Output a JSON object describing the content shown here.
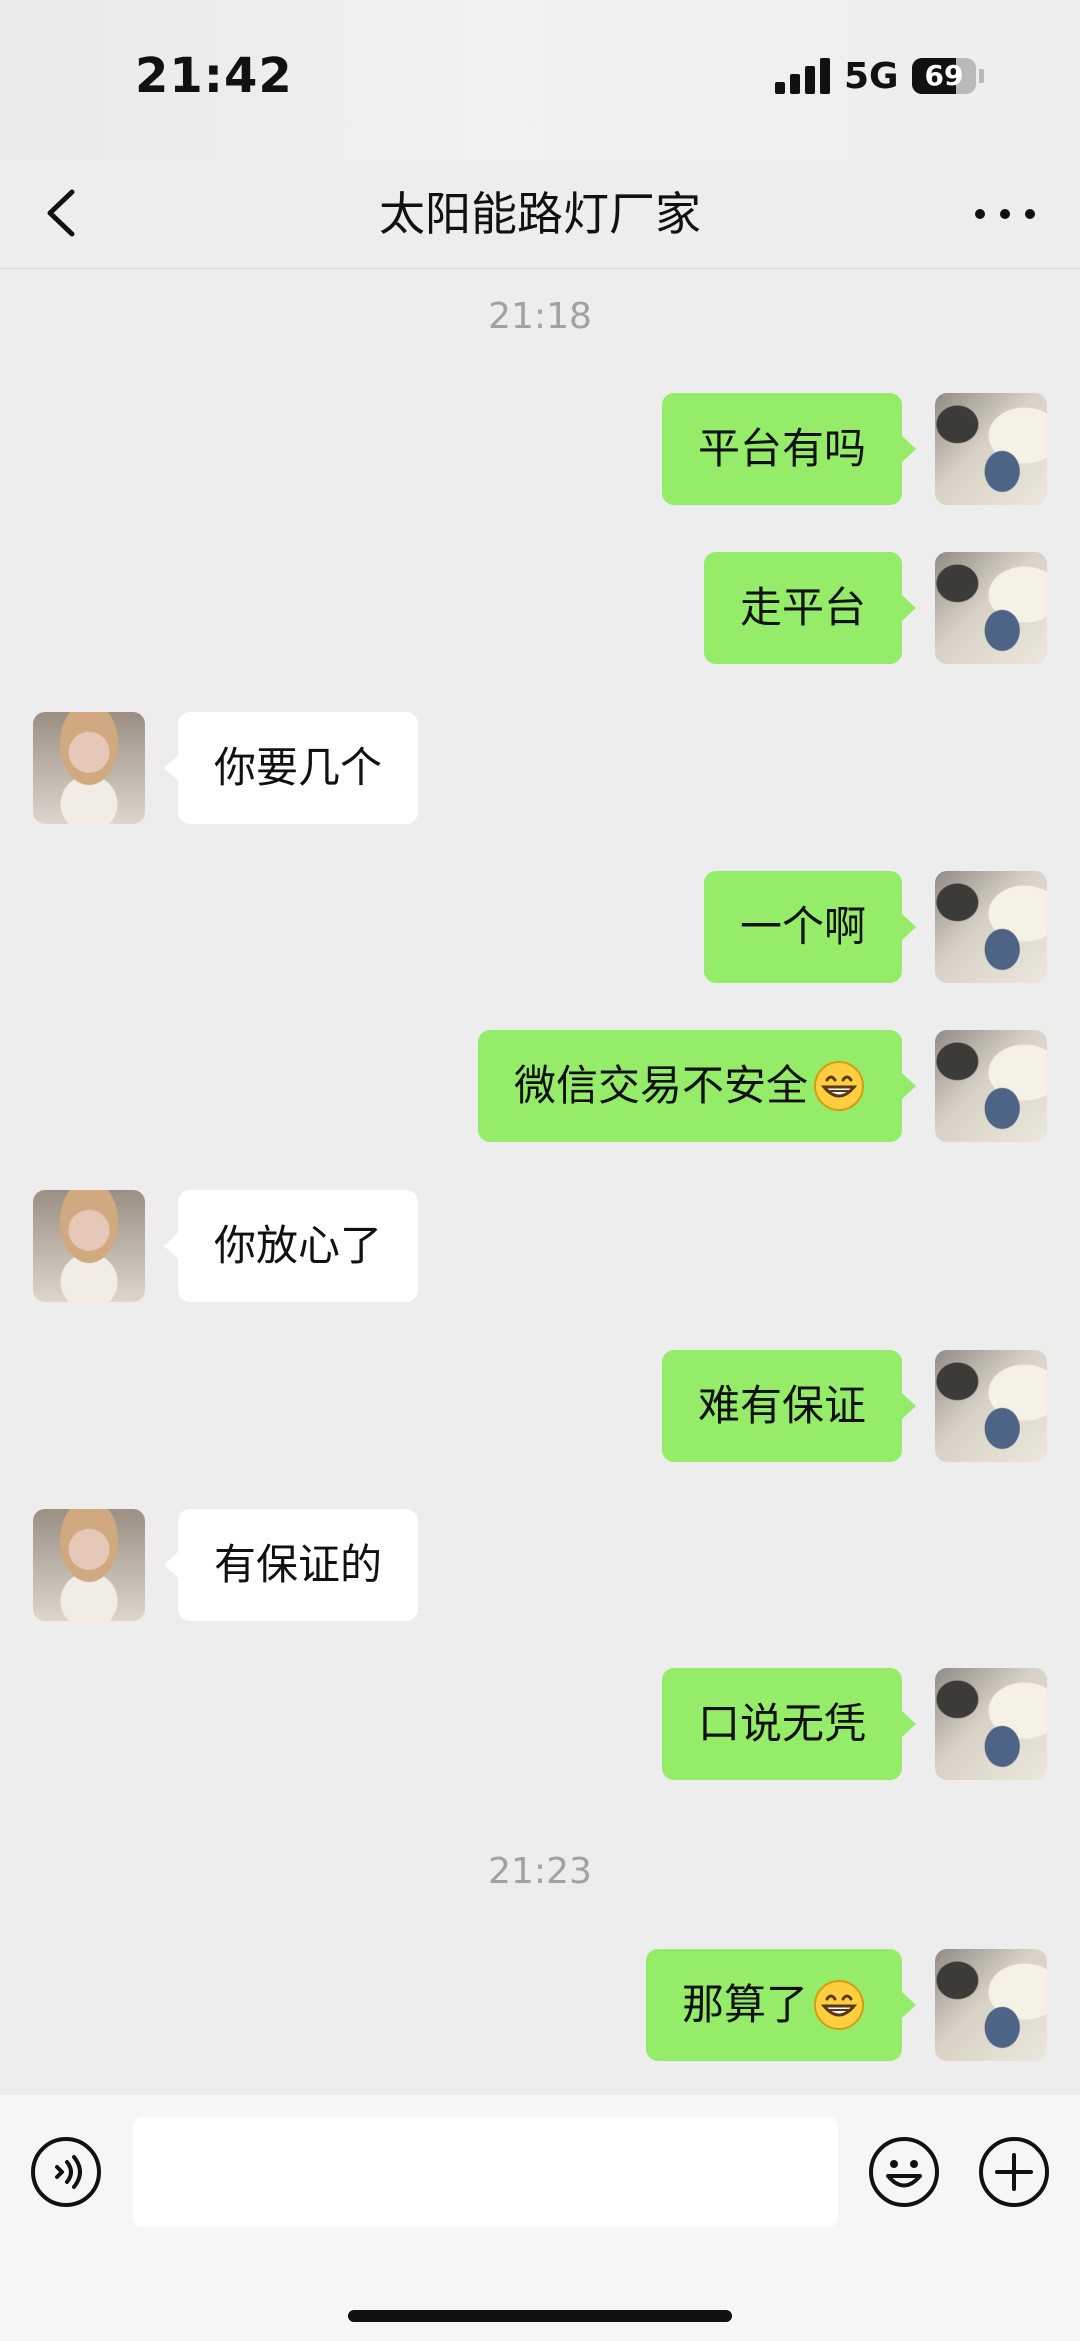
{
  "status_bar": {
    "time": "21:42",
    "network": "5G",
    "battery": "69",
    "battery_level": 0.69
  },
  "header": {
    "title": "太阳能路灯厂家",
    "back_icon": "back-chevron-icon",
    "more_icon": "more-dots-icon"
  },
  "timestamps": [
    "21:18",
    "21:23"
  ],
  "messages": [
    {
      "from": "me",
      "text": "平台有吗"
    },
    {
      "from": "me",
      "text": "走平台"
    },
    {
      "from": "contact",
      "text": "你要几个"
    },
    {
      "from": "me",
      "text": "一个啊"
    },
    {
      "from": "me",
      "text": "微信交易不安全",
      "emoji": "grinning-face-icon"
    },
    {
      "from": "contact",
      "text": "你放心了"
    },
    {
      "from": "me",
      "text": "难有保证"
    },
    {
      "from": "contact",
      "text": "有保证的"
    },
    {
      "from": "me",
      "text": "口说无凭"
    },
    {
      "from": "me",
      "text": "那算了",
      "emoji": "grinning-face-icon"
    }
  ],
  "input_bar": {
    "value": "",
    "voice_icon": "voice-mode-icon",
    "emoji_icon": "emoji-icon",
    "plus_icon": "plus-icon"
  },
  "colors": {
    "background": "#ededed",
    "my_bubble": "#95ec69",
    "contact_bubble": "#ffffff",
    "timestamp": "#a1a1a1"
  }
}
